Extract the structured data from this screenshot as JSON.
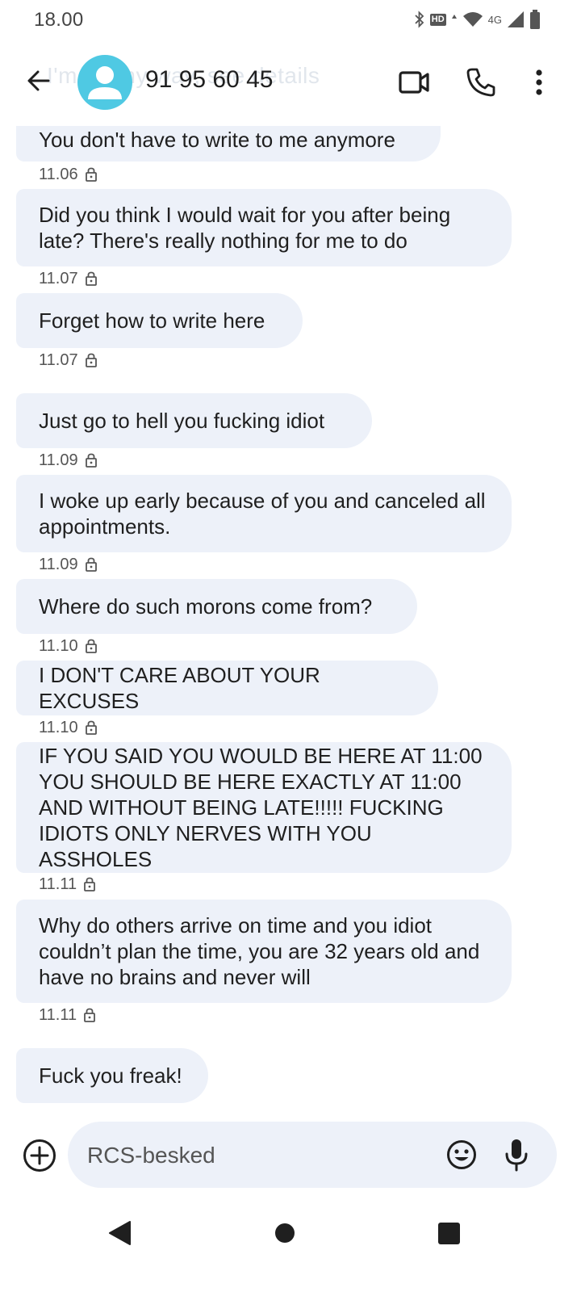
{
  "status_bar": {
    "time": "18.00",
    "hd_label": "HD",
    "network_label": "4G",
    "icons": [
      "bluetooth-icon",
      "hd-voice-icon",
      "wifi-icon",
      "cell-signal-icon",
      "battery-icon"
    ]
  },
  "app_bar": {
    "contact_name": "91 95 60 45",
    "ghost_text": "I'm on my way, see details",
    "icons": [
      "back-arrow-icon",
      "avatar-person-icon",
      "video-call-icon",
      "phone-call-icon",
      "more-vert-icon"
    ],
    "avatar_color": "#4fc9e3"
  },
  "messages": [
    {
      "text": "You don't have to write to me anymore",
      "time": "11.06"
    },
    {
      "text": "Did you think I would wait for you after being late? There's really nothing for me to do",
      "time": "11.07"
    },
    {
      "text": "Forget how to write here",
      "time": "11.07"
    },
    {
      "text": "Just go to hell you fucking idiot",
      "time": "11.09"
    },
    {
      "text": "I woke up early because of you and canceled all appointments.",
      "time": "11.09"
    },
    {
      "text": "Where do such morons come from?",
      "time": "11.10"
    },
    {
      "text": "I DON'T CARE ABOUT YOUR EXCUSES",
      "time": "11.10"
    },
    {
      "text": "IF YOU SAID YOU WOULD BE HERE AT 11:00 YOU SHOULD BE HERE EXACTLY AT 11:00 AND WITHOUT BEING LATE!!!!! FUCKING IDIOTS ONLY NERVES WITH YOU ASSHOLES",
      "time": "11.11"
    },
    {
      "text": "Why do others arrive on time and you idiot couldn’t plan the time, you are 32 years old and have no brains and never will",
      "time": "11.11"
    },
    {
      "text": "Fuck you freak!",
      "time": ""
    }
  ],
  "compose": {
    "placeholder": "RCS-besked",
    "icons": [
      "add-circle-icon",
      "emoji-icon",
      "microphone-icon"
    ]
  },
  "nav_bar": {
    "icons": [
      "nav-back-icon",
      "nav-home-icon",
      "nav-recents-icon"
    ]
  },
  "colors": {
    "bubble_bg": "#edf1f9",
    "text": "#1f1f1f",
    "secondary_text": "#555555"
  }
}
